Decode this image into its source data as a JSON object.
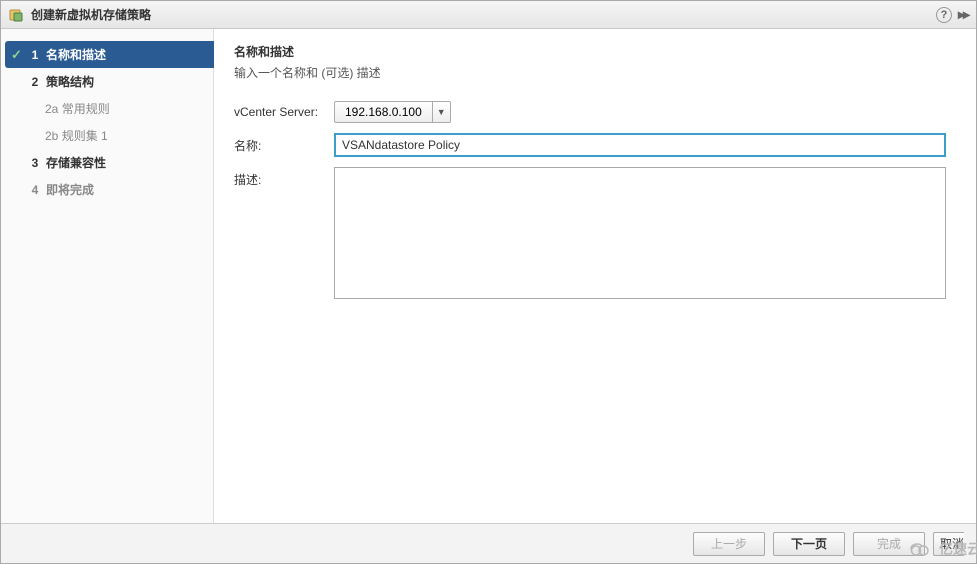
{
  "titlebar": {
    "title": "创建新虚拟机存储策略",
    "help_glyph": "?",
    "expand_glyph": "▸▸"
  },
  "sidebar": {
    "steps": [
      {
        "num": "1",
        "label": "名称和描述",
        "active": true,
        "checked": true
      },
      {
        "num": "2",
        "label": "策略结构"
      },
      {
        "num": "3",
        "label": "存储兼容性"
      },
      {
        "num": "4",
        "label": "即将完成",
        "inactive": true
      }
    ],
    "subs": [
      {
        "num": "2a",
        "label": "常用规则"
      },
      {
        "num": "2b",
        "label": "规则集 1"
      }
    ]
  },
  "content": {
    "title": "名称和描述",
    "subtitle": "输入一个名称和 (可选) 描述",
    "vcs_label": "vCenter Server:",
    "vcs_value": "192.168.0.100",
    "name_label": "名称:",
    "name_value": "VSANdatastore Policy",
    "desc_label": "描述:",
    "desc_value": ""
  },
  "footer": {
    "back": "上一步",
    "next": "下一页",
    "finish": "完成",
    "cancel": "取消"
  },
  "watermark": "亿速云"
}
